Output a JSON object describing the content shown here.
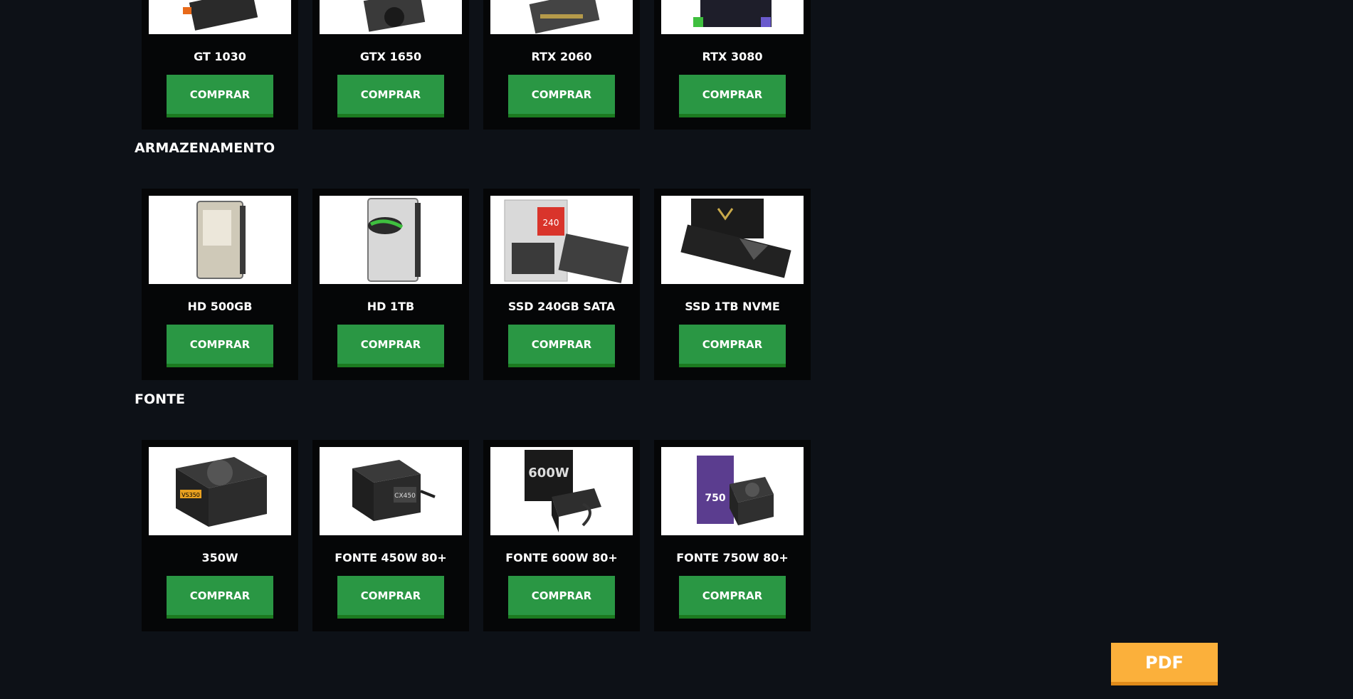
{
  "gpu": {
    "items": [
      {
        "name": "GT 1030",
        "button": "COMPRAR"
      },
      {
        "name": "GTX 1650",
        "button": "COMPRAR"
      },
      {
        "name": "RTX 2060",
        "button": "COMPRAR"
      },
      {
        "name": "RTX 3080",
        "button": "COMPRAR"
      }
    ]
  },
  "storage": {
    "title": "ARMAZENAMENTO",
    "items": [
      {
        "name": "HD 500GB",
        "button": "COMPRAR"
      },
      {
        "name": "HD 1TB",
        "button": "COMPRAR"
      },
      {
        "name": "SSD 240GB SATA",
        "button": "COMPRAR",
        "image_text": "240"
      },
      {
        "name": "SSD 1TB NVME",
        "button": "COMPRAR"
      }
    ]
  },
  "psu": {
    "title": "FONTE",
    "items": [
      {
        "name": "350W",
        "button": "COMPRAR",
        "image_text": "VS350"
      },
      {
        "name": "FONTE 450W 80+",
        "button": "COMPRAR",
        "image_text": "CX450"
      },
      {
        "name": "FONTE 600W 80+",
        "button": "COMPRAR",
        "image_text": "600W"
      },
      {
        "name": "FONTE 750W 80+",
        "button": "COMPRAR",
        "image_text": "750"
      }
    ]
  },
  "pdf_button": "PDF",
  "colors": {
    "background": "#0d1117",
    "card": "#050607",
    "buy_button": "#2a9744",
    "pdf_button": "#fbb03b"
  }
}
